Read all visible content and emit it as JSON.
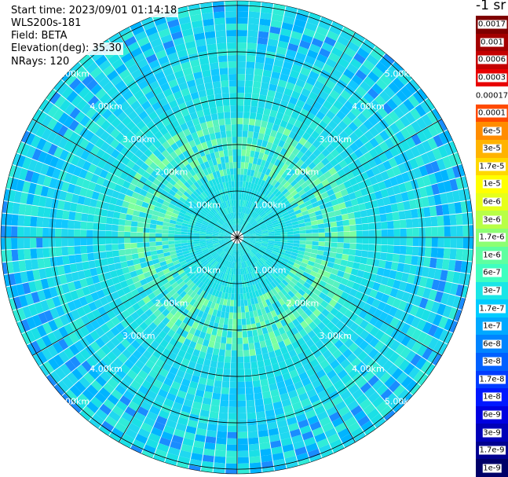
{
  "header": {
    "start_time": "Start time: 2023/09/01 01:14:18",
    "instrument": "WLS200s-181",
    "field": "Field: BETA",
    "elevation": "Elevation(deg): 35.30",
    "nrays": "NRays: 120"
  },
  "colorbar": {
    "unit": "-1 sr",
    "labels": [
      "0.0017",
      "0.001",
      "0.0006",
      "0.0003",
      "0.00017",
      "0.0001",
      "6e-5",
      "3e-5",
      "1.7e-5",
      "1e-5",
      "6e-6",
      "3e-6",
      "1.7e-6",
      "1e-6",
      "6e-7",
      "3e-7",
      "1.7e-7",
      "1e-7",
      "6e-8",
      "3e-8",
      "1.7e-8",
      "1e-8",
      "6e-9",
      "3e-9",
      "1.7e-9",
      "1e-9"
    ],
    "colors": [
      "#7f0000",
      "#a30000",
      "#c40000",
      "#e80000",
      "#ffffff",
      "#ff4a00",
      "#ff8c00",
      "#ffb300",
      "#ffd800",
      "#ffff00",
      "#e6ff1a",
      "#b8ff46",
      "#8cff73",
      "#5effa0",
      "#3effc0",
      "#1ae6e6",
      "#00ccff",
      "#00a8ff",
      "#0084ff",
      "#0060ff",
      "#003cff",
      "#0018ff",
      "#0000e0",
      "#0000b8",
      "#000090",
      "#000068"
    ]
  },
  "chart_data": {
    "type": "heatmap",
    "projection": "polar",
    "field": "BETA",
    "nrays": 120,
    "range_rings_km": [
      1,
      2,
      3,
      4,
      5,
      6
    ],
    "ring_labels": [
      "1.00km",
      "2.00km",
      "3.00km",
      "4.00km",
      "5.00km",
      "6.00km"
    ],
    "max_range_km": 5.1,
    "spoke_count": 12,
    "dominant_value_range": [
      "1.7e-7",
      "3e-8"
    ],
    "color_scale": "log",
    "value_range": [
      1e-09,
      0.0017
    ]
  }
}
